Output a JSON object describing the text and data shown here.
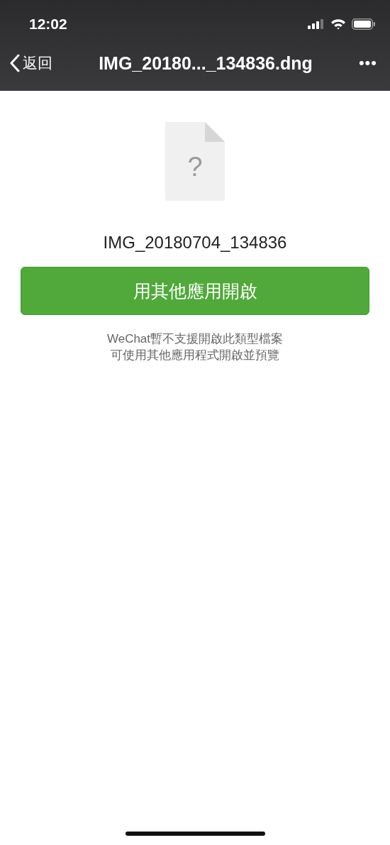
{
  "status_bar": {
    "time": "12:02"
  },
  "nav_bar": {
    "back": "返回",
    "title": "IMG_20180..._134836.dng",
    "more": "•••"
  },
  "file": {
    "icon_glyph": "?",
    "name": "IMG_20180704_134836"
  },
  "open_button": "用其他應用開啟",
  "hint": [
    "WeChat暫不支援開啟此類型檔案",
    "可使用其他應用程式開啟並預覽"
  ]
}
